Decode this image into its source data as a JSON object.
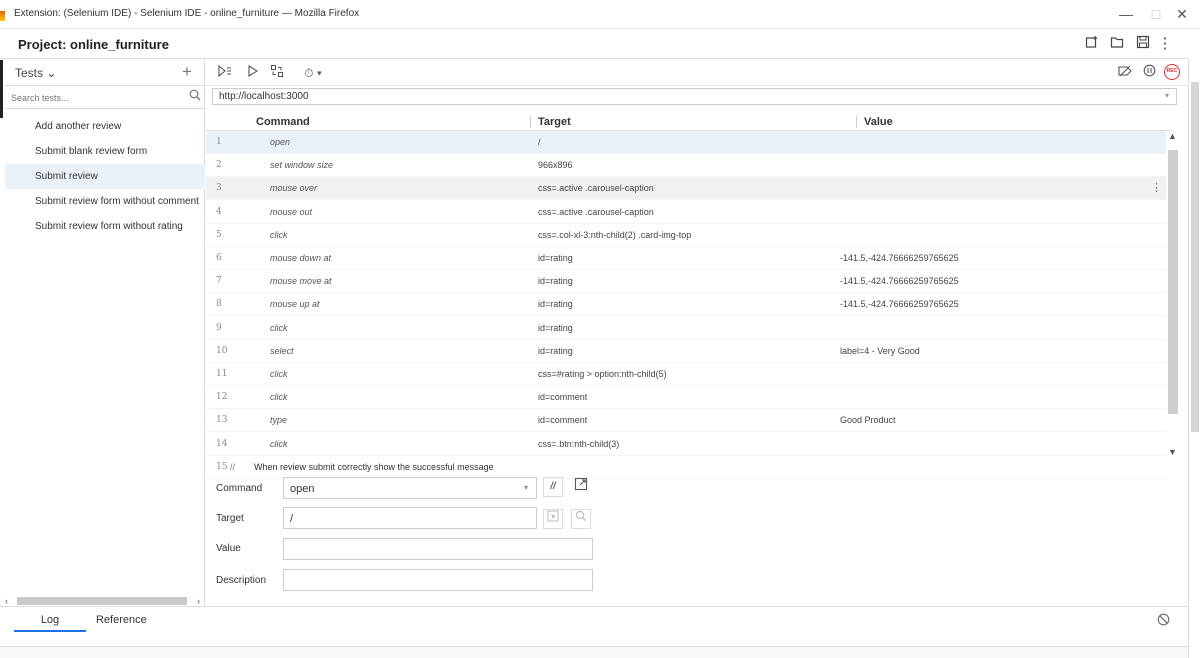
{
  "window": {
    "title": "Extension: (Selenium IDE) - Selenium IDE - online_furniture — Mozilla Firefox",
    "minimize": "—",
    "maximize": "□",
    "close": "✕"
  },
  "project": {
    "title": "Project: online_furniture"
  },
  "sidebar": {
    "header_label": "Tests ⌄",
    "add_label": "+",
    "search_placeholder": "Search tests...",
    "items": [
      {
        "label": "Add another review"
      },
      {
        "label": "Submit blank review form"
      },
      {
        "label": "Submit review"
      },
      {
        "label": "Submit review form without comment"
      },
      {
        "label": "Submit review form without rating"
      }
    ],
    "selected_index": 2
  },
  "toolbar": {
    "speed_label": "⏱ ▾"
  },
  "url": {
    "value": "http://localhost:3000"
  },
  "table": {
    "headers": {
      "command": "Command",
      "target": "Target",
      "value": "Value"
    },
    "rows": [
      {
        "n": "1",
        "command": "open",
        "target": "/",
        "value": ""
      },
      {
        "n": "2",
        "command": "set window size",
        "target": "966x896",
        "value": ""
      },
      {
        "n": "3",
        "command": "mouse over",
        "target": "css=.active .carousel-caption",
        "value": ""
      },
      {
        "n": "4",
        "command": "mouse out",
        "target": "css=.active .carousel-caption",
        "value": ""
      },
      {
        "n": "5",
        "command": "click",
        "target": "css=.col-xl-3:nth-child(2) .card-img-top",
        "value": ""
      },
      {
        "n": "6",
        "command": "mouse down at",
        "target": "id=rating",
        "value": "-141.5,-424.76666259765625"
      },
      {
        "n": "7",
        "command": "mouse move at",
        "target": "id=rating",
        "value": "-141.5,-424.76666259765625"
      },
      {
        "n": "8",
        "command": "mouse up at",
        "target": "id=rating",
        "value": "-141.5,-424.76666259765625"
      },
      {
        "n": "9",
        "command": "click",
        "target": "id=rating",
        "value": ""
      },
      {
        "n": "10",
        "command": "select",
        "target": "id=rating",
        "value": "label=4 - Very Good"
      },
      {
        "n": "11",
        "command": "click",
        "target": "css=#rating > option:nth-child(5)",
        "value": ""
      },
      {
        "n": "12",
        "command": "click",
        "target": "id=comment",
        "value": ""
      },
      {
        "n": "13",
        "command": "type",
        "target": "id=comment",
        "value": "Good Product"
      },
      {
        "n": "14",
        "command": "click",
        "target": "css=.btn:nth-child(3)",
        "value": ""
      }
    ],
    "comment_row": {
      "n": "15",
      "marker": "//",
      "text": "When review submit correctly show the successful message"
    },
    "kebab": "⋮"
  },
  "editor": {
    "command_label": "Command",
    "command_value": "open",
    "target_label": "Target",
    "target_value": "/",
    "value_label": "Value",
    "value_value": "",
    "description_label": "Description",
    "description_value": "",
    "comment_toggle": "//"
  },
  "bottom": {
    "log_tab": "Log",
    "reference_tab": "Reference"
  }
}
